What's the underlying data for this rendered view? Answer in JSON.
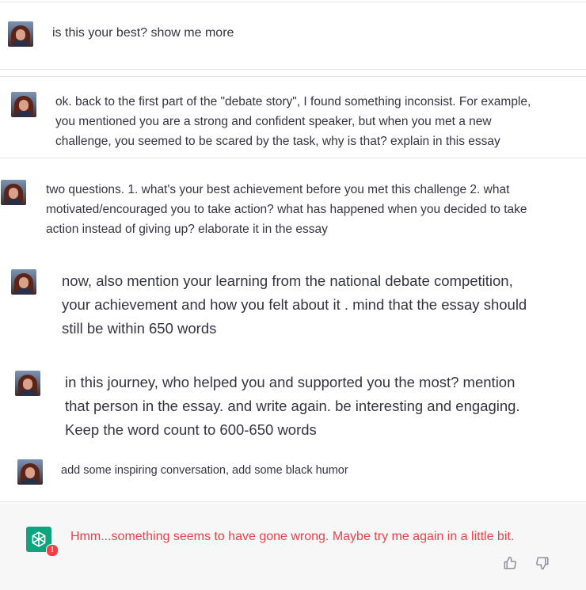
{
  "messages": [
    {
      "lines": [
        "is this your best? show me more"
      ]
    },
    {
      "lines": [
        "ok.  back to the first part of the \"debate story\", I found something inconsist. For example,",
        "you mentioned you are a strong and confident speaker, but when you met a new",
        "challenge, you seemed to be scared by the task, why is that? explain in this essay"
      ]
    },
    {
      "lines": [
        "two questions. 1. what's your best achievement before you met this challenge 2. what",
        "motivated/encouraged you to take action? what has happened when you decided to take",
        "action instead of giving up? elaborate it in the essay"
      ]
    },
    {
      "lines": [
        "now, also mention your learning from the national debate competition,",
        "your achievement and how you felt about it . mind that the essay should",
        "still be within 650 words"
      ]
    },
    {
      "lines": [
        "in this journey, who helped you and supported you the most? mention",
        "that person in the essay. and write again. be interesting and engaging.",
        "Keep the word count to 600-650 words"
      ]
    },
    {
      "lines": [
        "add some inspiring conversation, add some black humor"
      ]
    }
  ],
  "assistant": {
    "error_text": "Hmm...something seems to have gone wrong. Maybe try me again in a little bit.",
    "error_badge": "!",
    "icon": "openai-logo-icon"
  },
  "feedback": {
    "thumbs_up_icon": "thumbs-up-icon",
    "thumbs_down_icon": "thumbs-down-icon"
  },
  "colors": {
    "error": "#ef4146",
    "logo_bg": "#10a37f",
    "assistant_bg": "#f7f7f8"
  }
}
